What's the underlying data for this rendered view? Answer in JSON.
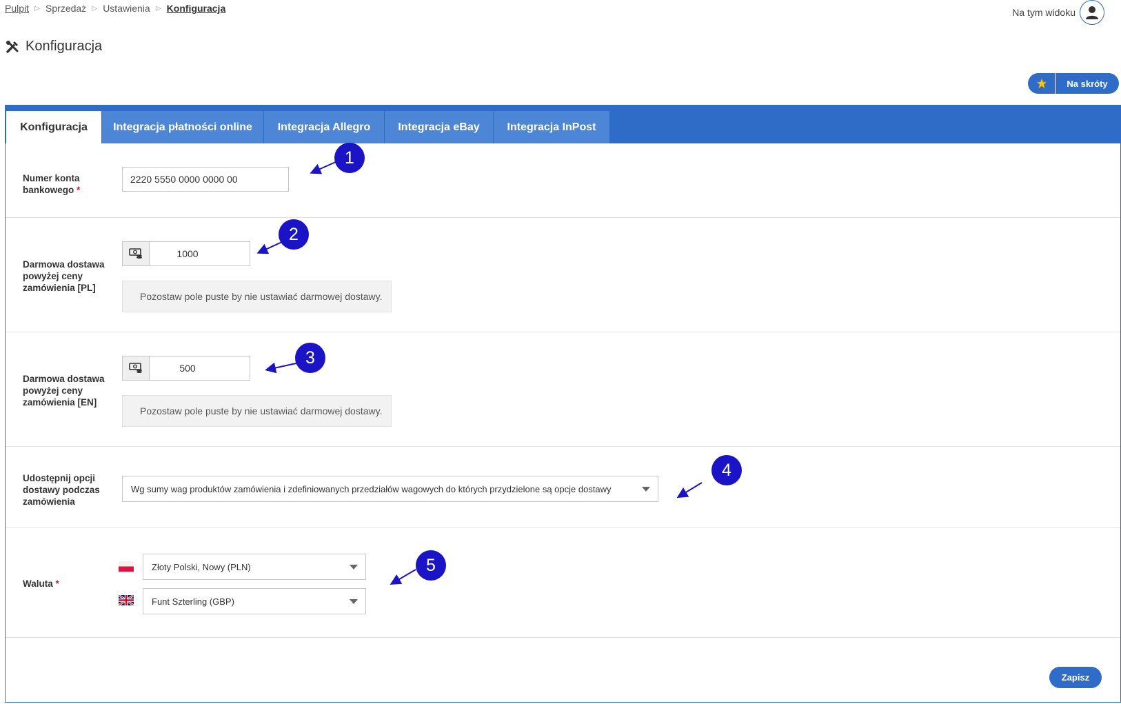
{
  "breadcrumb": {
    "items": [
      "Pulpit",
      "Sprzedaż",
      "Ustawienia"
    ],
    "current": "Konfiguracja"
  },
  "view_user_label": "Na tym widoku",
  "page_title": "Konfiguracja",
  "shortcut_label": "Na skróty",
  "tabs": [
    "Konfiguracja",
    "Integracja płatności online",
    "Integracja Allegro",
    "Integracja eBay",
    "Integracja InPost"
  ],
  "form": {
    "bank_account": {
      "label_line1": "Numer konta",
      "label_line2": "bankowego",
      "required": "*",
      "value": "2220 5550 0000 0000 00"
    },
    "free_shipping_pl": {
      "label_line1": "Darmowa dostawa",
      "label_line2": "powyżej ceny",
      "label_line3": "zamówienia [PL]",
      "value": "1000",
      "hint": "Pozostaw pole puste by nie ustawiać darmowej dostawy."
    },
    "free_shipping_en": {
      "label_line1": "Darmowa dostawa",
      "label_line2": "powyżej ceny",
      "label_line3": "zamówienia [EN]",
      "value": "500",
      "hint": "Pozostaw pole puste by nie ustawiać darmowej dostawy."
    },
    "shipping_options": {
      "label_line1": "Udostępnij opcji",
      "label_line2": "dostawy podczas",
      "label_line3": "zamówienia",
      "value": "Wg sumy wag produktów zamówienia i zdefiniowanych przedziałów wagowych do których przydzielone są opcje dostawy"
    },
    "currency": {
      "label": "Waluta",
      "required": "*",
      "pl_value": "Złoty Polski, Nowy (PLN)",
      "en_value": "Funt Szterling (GBP)"
    }
  },
  "save_label": "Zapisz",
  "annotations": [
    "1",
    "2",
    "3",
    "4",
    "5"
  ],
  "colors": {
    "accent": "#2f6cc8",
    "tab_inactive": "#4d86d6",
    "annotation": "#1a14c6",
    "required": "#d02020"
  },
  "icons": {
    "title": "tools-icon",
    "user": "user-icon",
    "star": "star-icon",
    "money": "money-icon"
  }
}
